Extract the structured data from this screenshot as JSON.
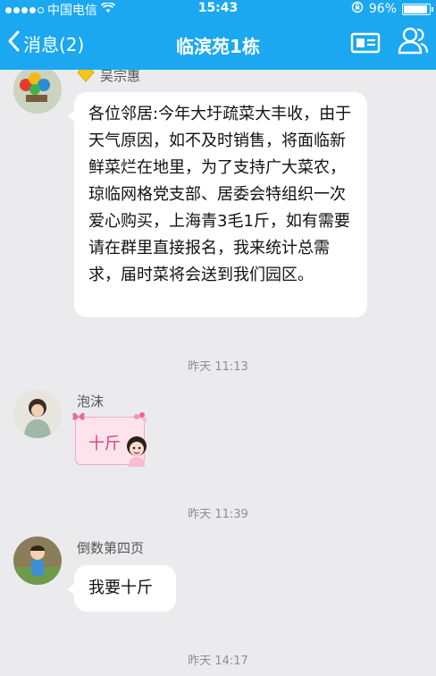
{
  "status_bar": {
    "carrier": "中国电信",
    "time": "15:43",
    "battery_percent": "96%",
    "battery_level": 0.96
  },
  "nav": {
    "back_label": "消息(2)",
    "title": "临滨苑1栋"
  },
  "messages": [
    {
      "sender": "吴宗惠",
      "text": "各位邻居:今年大圩疏菜大丰收，由于天气原因，如不及时销售，将面临新鲜菜烂在地里，为了支持广大菜农，琼临网格党支部、居委会特组织一次爱心购买，上海青3毛1斤，如有需要请在群里直接报名，我来统计总需求，届时菜将会送到我们园区。"
    },
    {
      "sender": "泡沫",
      "text": "十斤"
    },
    {
      "sender": "倒数第四页",
      "text": "我要十斤"
    }
  ],
  "timestamps": [
    "昨天 11:13",
    "昨天 11:39",
    "昨天 14:17"
  ],
  "colors": {
    "accent": "#1ba8f0",
    "background": "#ebebed",
    "bubble": "#ffffff",
    "sticker_pink": "#fde3ec"
  },
  "icons": [
    "signal-icon",
    "wifi-icon",
    "lock-rotation-icon",
    "battery-icon",
    "back-chevron-icon",
    "group-card-icon",
    "group-members-icon",
    "vip-diamond-icon"
  ]
}
